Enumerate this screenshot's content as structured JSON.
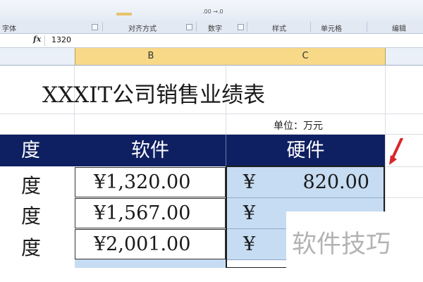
{
  "ribbon": {
    "groups": [
      {
        "label": "字体"
      },
      {
        "label": "对齐方式"
      },
      {
        "label": "数字"
      },
      {
        "label": "样式"
      },
      {
        "label": "单元格"
      },
      {
        "label": "编辑"
      }
    ],
    "number_format_hint": ".00 →.0"
  },
  "formula_bar": {
    "fx_label": "fx",
    "value": "1320"
  },
  "columns": {
    "b": "B",
    "c": "C"
  },
  "sheet": {
    "title": "XXXIT公司销售业绩表",
    "unit": "单位：万元",
    "header": {
      "col_a": "度",
      "col_b": "软件",
      "col_c": "硬件"
    },
    "rows": [
      {
        "label": "度",
        "software": "¥1,320.00",
        "hardware_currency": "¥",
        "hardware_value": "820.00"
      },
      {
        "label": "度",
        "software": "¥1,567.00",
        "hardware_currency": "¥",
        "hardware_value": ""
      },
      {
        "label": "度",
        "software": "¥2,001.00",
        "hardware_currency": "¥",
        "hardware_value": ""
      }
    ]
  },
  "watermark": "软件技巧",
  "colors": {
    "header_fill": "#0f2062",
    "selected_fill": "#c6dcf2",
    "column_header_selected": "#f8d987",
    "annotation_arrow": "#d9262b"
  }
}
